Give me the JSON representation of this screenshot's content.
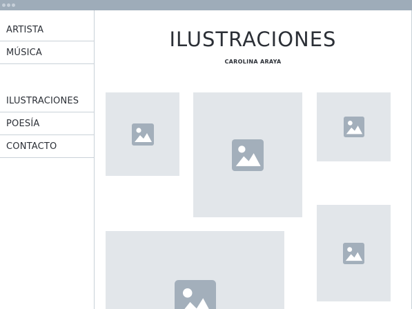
{
  "window": {
    "controls": [
      "close",
      "minimize",
      "maximize"
    ]
  },
  "sidebar": {
    "primary": [
      {
        "label": "ARTISTA"
      },
      {
        "label": "MÚSICA"
      }
    ],
    "secondary": [
      {
        "label": "ILUSTRACIONES"
      },
      {
        "label": "POESÍA"
      },
      {
        "label": "CONTACTO"
      }
    ]
  },
  "main": {
    "title": "ILUSTRACIONES",
    "subtitle": "CAROLINA ARAYA",
    "gallery": [
      {
        "icon": "image-icon"
      },
      {
        "icon": "image-icon"
      },
      {
        "icon": "image-icon"
      },
      {
        "icon": "image-icon"
      },
      {
        "icon": "image-icon"
      }
    ]
  },
  "colors": {
    "titlebar": "#9eacb9",
    "placeholder": "#e2e6ea",
    "icon": "#a3afbb",
    "divider": "#c9d1d8",
    "text": "#2b2f36"
  }
}
